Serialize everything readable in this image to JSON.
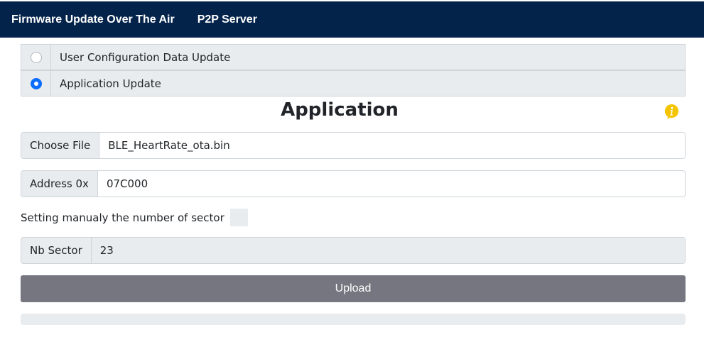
{
  "navbar": {
    "links": [
      {
        "label": "Firmware Update Over The Air"
      },
      {
        "label": "P2P Server"
      }
    ],
    "background": "#03234b"
  },
  "update_type": {
    "options": [
      {
        "label": "User Configuration Data Update",
        "checked": false
      },
      {
        "label": "Application Update",
        "checked": true
      }
    ]
  },
  "section": {
    "title": "Application",
    "info_icon": "info-icon",
    "info_color": "#f5c400"
  },
  "file": {
    "button_label": "Choose File",
    "value": "BLE_HeartRate_ota.bin"
  },
  "address": {
    "label": "Address 0x",
    "value": "07C000"
  },
  "manual_sector": {
    "label": "Setting manualy the number of sector",
    "checked": false
  },
  "nb_sector": {
    "label": "Nb Sector",
    "value": "23"
  },
  "upload": {
    "label": "Upload",
    "color": "#767680"
  },
  "progress": {
    "value": 0
  }
}
